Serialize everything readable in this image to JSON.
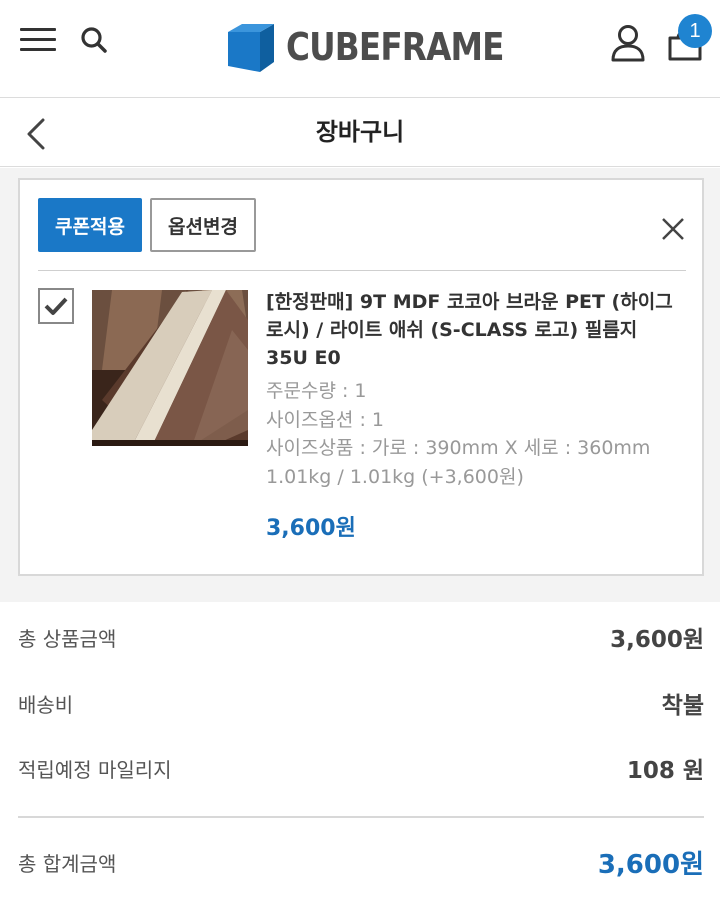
{
  "header": {
    "brand": "CUBEFRAME",
    "cart_count": "1",
    "colors": {
      "brand_blue": "#1a78c7",
      "logo_text": "#4d4d4d",
      "badge": "#1f84d1"
    },
    "icons": [
      "menu-icon",
      "search-icon",
      "logo-cube-icon",
      "user-icon",
      "cart-icon"
    ]
  },
  "title_bar": {
    "title": "장바구니"
  },
  "cart_item": {
    "coupon_button": "쿠폰적용",
    "option_button": "옵션변경",
    "checked": true,
    "name": "[한정판매] 9T MDF 코코아 브라운 PET (하이그로시) / 라이트 애쉬 (S-CLASS 로고) 필름지 35U E0",
    "name_lines": [
      "[한정판매] 9T MDF 코코아 브라운 PET (하이그",
      "로시) / 라이트 애쉬 (S-CLASS 로고) 필름지",
      "35U E0"
    ],
    "options": [
      "주문수량 : 1",
      "사이즈옵션 : 1",
      "사이즈상품 : 가로 : 390mm X 세로 : 360mm",
      "1.01kg / 1.01kg (+3,600원)"
    ],
    "price": "3,600원"
  },
  "summary": {
    "rows": [
      {
        "label": "총 상품금액",
        "value": "3,600원"
      },
      {
        "label": "배송비",
        "value": "착불"
      },
      {
        "label": "적립예정 마일리지",
        "value": "108 원"
      }
    ],
    "total": {
      "label": "총 합계금액",
      "value": "3,600원"
    }
  }
}
